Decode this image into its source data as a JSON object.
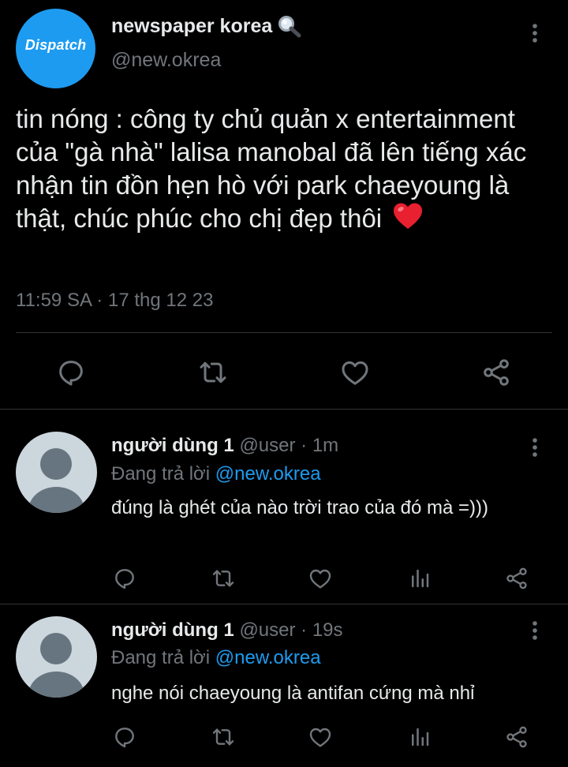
{
  "main_tweet": {
    "avatar_brand": "Dispatch",
    "display_name": "newspaper korea",
    "name_emoji": "magnifying-glass-emoji",
    "handle": "@new.okrea",
    "text": "tin nóng : công ty chủ quản x entertainment của \"gà nhà\" lalisa manobal đã lên tiếng xác nhận tin đồn hẹn hò với park chaeyoung là thật, chúc phúc cho chị đẹp thôi",
    "text_emoji": "red-heart-emoji",
    "timestamp": "11:59 SA · 17 thg 12 23",
    "actions": [
      "reply-icon",
      "retweet-icon",
      "like-icon",
      "share-icon"
    ]
  },
  "replies": [
    {
      "display_name": "người dùng 1",
      "handle": "@user",
      "time": "· 1m",
      "replying_prefix": "Đang trả lời",
      "replying_to": "@new.okrea",
      "text": "đúng là ghét của nào trời trao của đó mà =)))"
    },
    {
      "display_name": "người dùng 1",
      "handle": "@user",
      "time": "· 19s",
      "replying_prefix": "Đang trả lời",
      "replying_to": "@new.okrea",
      "text": "nghe nói chaeyoung là antifan cứng mà nhỉ"
    }
  ],
  "colors": {
    "background": "#000000",
    "text": "#e7e9ea",
    "muted": "#71767b",
    "link": "#1d9bf0",
    "divider": "#2f3336",
    "avatar_blue": "#1d9bf0"
  }
}
